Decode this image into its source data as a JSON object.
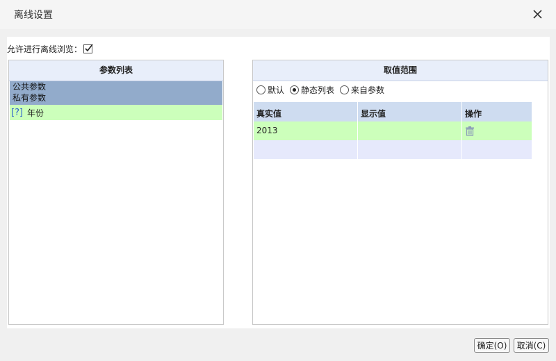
{
  "window": {
    "title": "离线设置",
    "close_icon": "close-icon"
  },
  "allow_offline": {
    "label": "允许进行离线浏览：",
    "checked": true
  },
  "param_list": {
    "header": "参数列表",
    "groups": [
      "公共参数",
      "私有参数"
    ],
    "params": [
      {
        "icon": "question-icon",
        "icon_text": "[?]",
        "name": "年份"
      }
    ]
  },
  "value_range": {
    "header": "取值范围",
    "options": [
      {
        "label": "默认",
        "selected": false
      },
      {
        "label": "静态列表",
        "selected": true
      },
      {
        "label": "来自参数",
        "selected": false
      }
    ],
    "columns": [
      "真实值",
      "显示值",
      "操作"
    ],
    "rows": [
      {
        "real": "2013",
        "display": "",
        "action_icon": "trash-icon"
      }
    ]
  },
  "footer": {
    "ok_label": "确定(O)",
    "cancel_label": "取消(C)"
  }
}
